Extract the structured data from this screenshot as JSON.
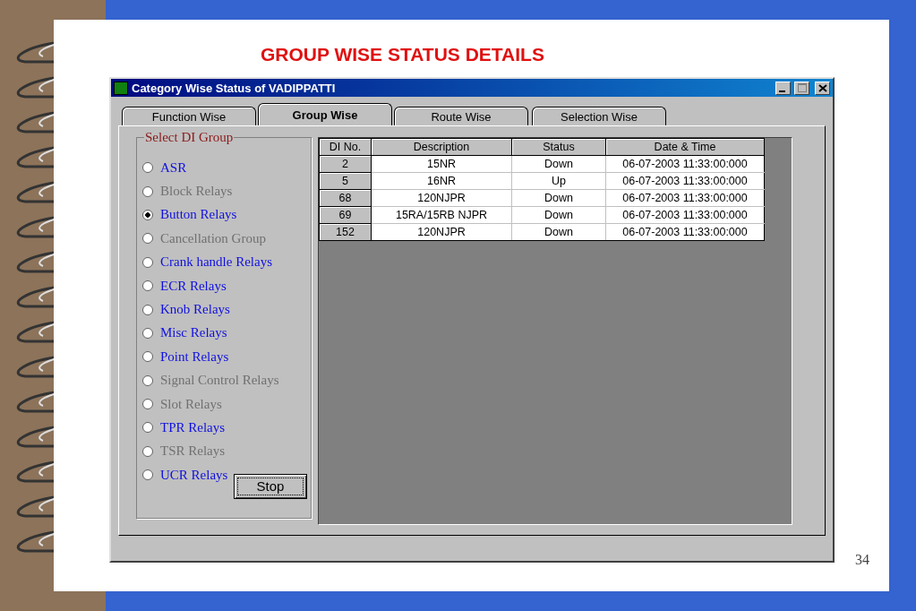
{
  "slide": {
    "title": "GROUP WISE STATUS DETAILS",
    "page_number": "34"
  },
  "window": {
    "title": "Category Wise Status of VADIPPATTI"
  },
  "tabs": [
    {
      "label": "Function Wise",
      "selected": false
    },
    {
      "label": "Group Wise",
      "selected": true
    },
    {
      "label": "Route Wise",
      "selected": false
    },
    {
      "label": "Selection Wise",
      "selected": false
    }
  ],
  "group": {
    "title": "Select DI Group",
    "options": [
      {
        "label": "ASR",
        "selected": false,
        "disabled": false
      },
      {
        "label": "Block Relays",
        "selected": false,
        "disabled": true
      },
      {
        "label": "Button Relays",
        "selected": true,
        "disabled": false
      },
      {
        "label": "Cancellation Group",
        "selected": false,
        "disabled": true
      },
      {
        "label": "Crank handle Relays",
        "selected": false,
        "disabled": false
      },
      {
        "label": "ECR Relays",
        "selected": false,
        "disabled": false
      },
      {
        "label": "Knob Relays",
        "selected": false,
        "disabled": false
      },
      {
        "label": "Misc Relays",
        "selected": false,
        "disabled": false
      },
      {
        "label": "Point Relays",
        "selected": false,
        "disabled": false
      },
      {
        "label": "Signal Control Relays",
        "selected": false,
        "disabled": true
      },
      {
        "label": "Slot Relays",
        "selected": false,
        "disabled": true
      },
      {
        "label": "TPR Relays",
        "selected": false,
        "disabled": false
      },
      {
        "label": "TSR Relays",
        "selected": false,
        "disabled": true
      },
      {
        "label": "UCR Relays",
        "selected": false,
        "disabled": false
      }
    ]
  },
  "stop_button": "Stop",
  "table": {
    "columns": [
      "DI No.",
      "Description",
      "Status",
      "Date & Time"
    ],
    "rows": [
      [
        "2",
        "15NR",
        "Down",
        "06-07-2003 11:33:00:000"
      ],
      [
        "5",
        "16NR",
        "Up",
        "06-07-2003 11:33:00:000"
      ],
      [
        "68",
        "120NJPR",
        "Down",
        "06-07-2003 11:33:00:000"
      ],
      [
        "69",
        "15RA/15RB NJPR",
        "Down",
        "06-07-2003 11:33:00:000"
      ],
      [
        "152",
        "120NJPR",
        "Down",
        "06-07-2003 11:33:00:000"
      ]
    ]
  }
}
